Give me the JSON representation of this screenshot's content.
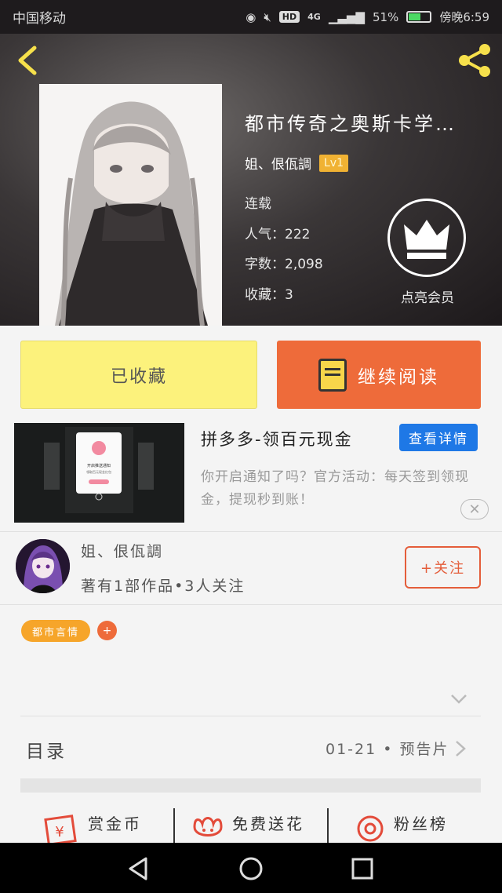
{
  "status_bar": {
    "carrier": "中国移动",
    "network": "4G",
    "hd": "HD",
    "battery": "51%",
    "time": "傍晚6:59",
    "battery_level": 0.51
  },
  "book": {
    "title": "都市传奇之奥斯卡学…",
    "author": "姐、佷佤調",
    "level": "Lv1",
    "status": "连载",
    "popularity": "人气：222",
    "word_count": "字数：2,098",
    "favorites": "收藏：3",
    "vip_label": "点亮会员"
  },
  "actions": {
    "collect": "已收藏",
    "read": "继续阅读"
  },
  "ad": {
    "title": "拼多多-领百元现金",
    "button": "查看详情",
    "description": "你开启通知了吗？官方活动：每天签到领现金，提现秒到账！",
    "popup_line1": "开启推送通知",
    "popup_line2": "领取百元现金红包"
  },
  "author": {
    "name": "姐、佷佤調",
    "stats": "著有1部作品•3人关注",
    "follow": "+关注"
  },
  "tags": [
    {
      "label": "都市言情"
    }
  ],
  "tag_add": "+",
  "toc": {
    "title": "目录",
    "info": "01-21 • 预告片"
  },
  "bottom_tabs": [
    {
      "label": "赏金币",
      "icon": "coin-envelope-icon"
    },
    {
      "label": "免费送花",
      "icon": "flower-icon"
    },
    {
      "label": "粉丝榜",
      "icon": "ribbon-medal-icon"
    }
  ],
  "colors": {
    "accent_orange": "#ee6b3a",
    "collect_yellow": "#fcf27c",
    "ad_blue": "#1e78e6",
    "tag_orange": "#f6a52a"
  }
}
